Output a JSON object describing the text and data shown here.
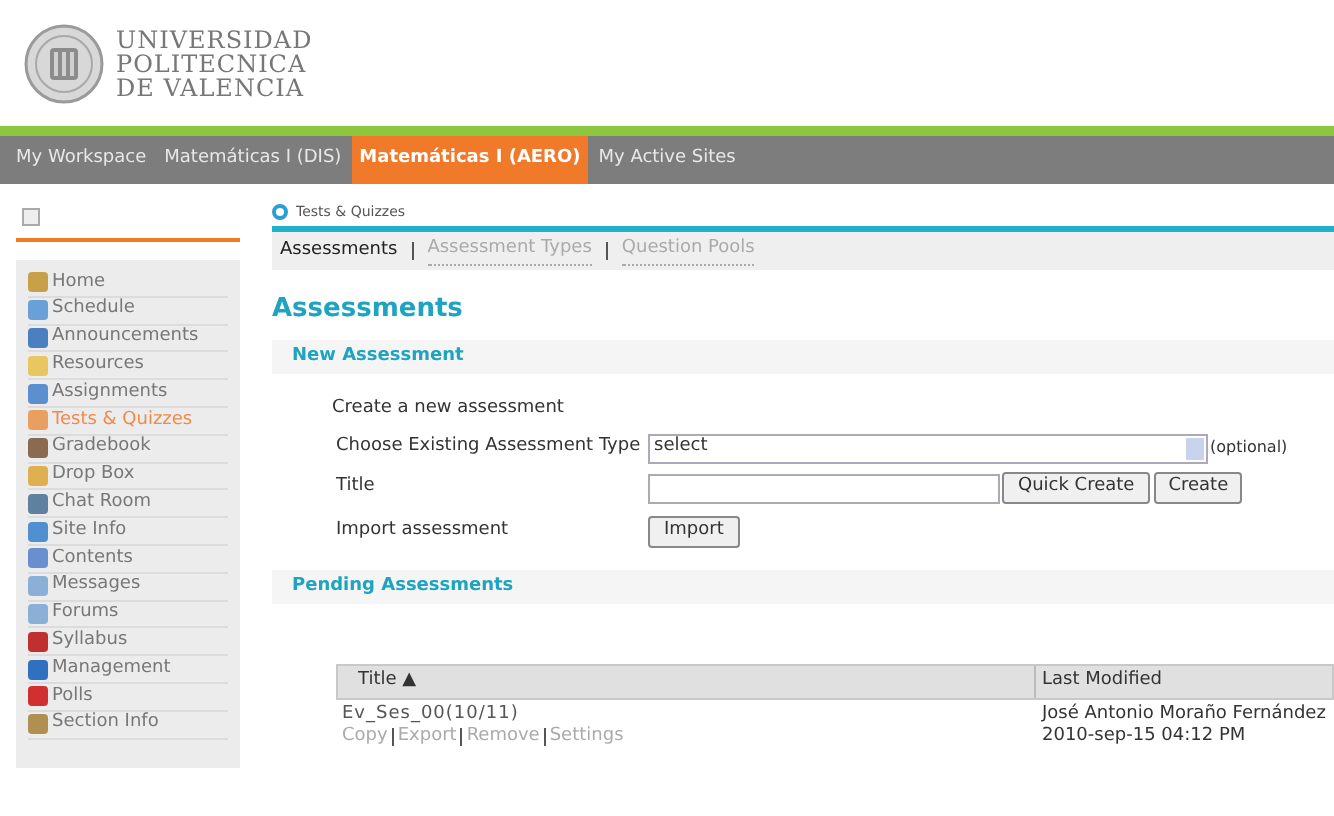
{
  "header": {
    "institution_lines": [
      "UNIVERSIDAD",
      "POLITECNICA",
      "DE VALENCIA"
    ]
  },
  "site_tabs": [
    {
      "label": "My Workspace",
      "selected": false
    },
    {
      "label": "Matemáticas I (DIS)",
      "selected": false
    },
    {
      "label": "Matemáticas I (AERO)",
      "selected": true
    },
    {
      "label": "My Active Sites",
      "selected": false
    }
  ],
  "tool_menu": [
    {
      "label": "Home",
      "selected": false
    },
    {
      "label": "Schedule",
      "selected": false
    },
    {
      "label": "Announcements",
      "selected": false
    },
    {
      "label": "Resources",
      "selected": false
    },
    {
      "label": "Assignments",
      "selected": false
    },
    {
      "label": "Tests & Quizzes",
      "selected": true
    },
    {
      "label": "Gradebook",
      "selected": false
    },
    {
      "label": "Drop Box",
      "selected": false
    },
    {
      "label": "Chat Room",
      "selected": false
    },
    {
      "label": "Site Info",
      "selected": false
    },
    {
      "label": "Contents",
      "selected": false
    },
    {
      "label": "Messages",
      "selected": false
    },
    {
      "label": "Forums",
      "selected": false
    },
    {
      "label": "Syllabus",
      "selected": false
    },
    {
      "label": "Management",
      "selected": false
    },
    {
      "label": "Polls",
      "selected": false
    },
    {
      "label": "Section Info",
      "selected": false
    }
  ],
  "tool_title": "Tests & Quizzes",
  "sub_nav": [
    {
      "label": "Assessments",
      "selected": true
    },
    {
      "label": "Assessment Types",
      "selected": false
    },
    {
      "label": "Question Pools",
      "selected": false
    }
  ],
  "page_title": "Assessments",
  "new_assessment": {
    "heading": "New Assessment",
    "intro": "Create a new assessment",
    "type_label": "Choose Existing Assessment Type",
    "type_value": "select",
    "type_note": "(optional)",
    "title_label": "Title",
    "quick_create_button": "Quick Create",
    "create_button": "Create",
    "import_label": "Import assessment",
    "import_button": "Import"
  },
  "pending": {
    "heading": "Pending Assessments",
    "columns": [
      "Title ▲",
      "Last Modified"
    ],
    "rows": [
      {
        "title": "Ev_Ses_00(10/11)",
        "actions": [
          "Copy",
          "Export",
          "Remove",
          "Settings"
        ],
        "modified_by": "José Antonio Moraño Fernández",
        "modified_date": "2010-sep-15 04:12 PM"
      }
    ]
  }
}
